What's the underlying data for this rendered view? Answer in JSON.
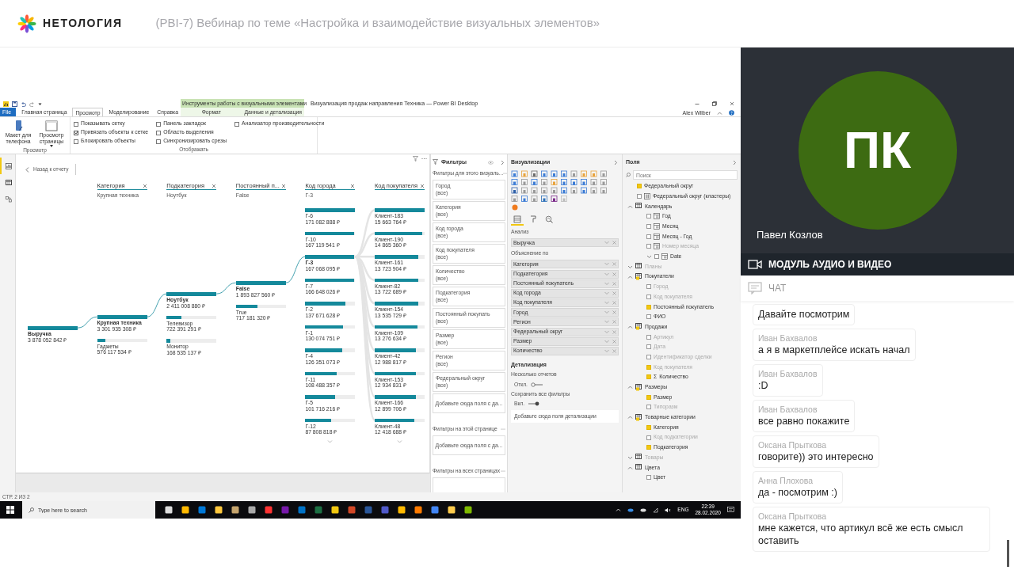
{
  "header": {
    "logo": "НЕТОЛОГИЯ",
    "title": "(PBI-7) Вебинар по теме «Настройка и взаимодействие визуальных элементов»"
  },
  "powerbi": {
    "window_title": "Визуализация продаж направления Техника — Power BI Desktop",
    "context_group": "Инструменты работы с визуальными элементами",
    "user": "Alex Wilber",
    "tabs": [
      {
        "label": "File",
        "kind": "file",
        "selected": false
      },
      {
        "label": "Главная страница",
        "kind": "main",
        "selected": false
      },
      {
        "label": "Просмотр",
        "kind": "main",
        "selected": true
      },
      {
        "label": "Моделирование",
        "kind": "main",
        "selected": false
      },
      {
        "label": "Справка",
        "kind": "main",
        "selected": false
      },
      {
        "label": "Формат",
        "kind": "context",
        "selected": false
      },
      {
        "label": "Данные и детализация",
        "kind": "context",
        "selected": false
      }
    ],
    "ribbon": {
      "buttons": [
        {
          "label": "Макет для телефона",
          "kind": "phone"
        },
        {
          "label": "Просмотр страницы",
          "kind": "page"
        }
      ],
      "view_group": "Просмотр",
      "checkboxes": [
        {
          "label": "Показывать сетку",
          "checked": false
        },
        {
          "label": "Привязать объекты к сетке",
          "checked": true
        },
        {
          "label": "Блокировать объекты",
          "checked": false
        },
        {
          "label": "Панель закладок",
          "checked": false
        },
        {
          "label": "Область выделения",
          "checked": false
        },
        {
          "label": "Синхронизировать срезы",
          "checked": false
        },
        {
          "label": "Анализатор производительности",
          "checked": false
        }
      ],
      "show_group": "Отображать"
    },
    "rail": [
      {
        "kind": "report",
        "selected": true
      },
      {
        "kind": "data",
        "selected": false
      },
      {
        "kind": "model",
        "selected": false
      }
    ],
    "decomposition_tree": {
      "back_link": "Назад к отчету",
      "columns": [
        {
          "nodes": [
            {
              "label": "Выручка",
              "value": "3 878 052 842 ₽",
              "level": 1,
              "selected": true
            }
          ]
        },
        {
          "header": "Категория",
          "filter": "Крупная техника",
          "nodes": [
            {
              "label": "Крупная техника",
              "value": "3 301 935 308 ₽",
              "level": 1,
              "selected": true
            },
            {
              "label": "Гаджеты",
              "value": "576 117 534 ₽",
              "level": 0.17,
              "selected": false
            }
          ]
        },
        {
          "header": "Подкатегория",
          "filter": "Ноутбук",
          "nodes": [
            {
              "label": "Ноутбук",
              "value": "2 411 008 880 ₽",
              "level": 1,
              "selected": true
            },
            {
              "label": "Телевизор",
              "value": "722 391 291 ₽",
              "level": 0.3,
              "selected": false
            },
            {
              "label": "Монитор",
              "value": "168 535 137 ₽",
              "level": 0.07,
              "selected": false
            }
          ]
        },
        {
          "header": "Постоянный п...",
          "filter": "False",
          "nodes": [
            {
              "label": "False",
              "value": "1 893 827 560 ₽",
              "level": 1,
              "selected": true
            },
            {
              "label": "True",
              "value": "717 181 320 ₽",
              "level": 0.43,
              "selected": false
            }
          ]
        },
        {
          "header": "Код города",
          "filter": "Г-3",
          "more": true,
          "nodes": [
            {
              "label": "Г-6",
              "value": "171 082 888 ₽",
              "level": 1,
              "selected": false
            },
            {
              "label": "Г-10",
              "value": "167 119 541 ₽",
              "level": 0.98,
              "selected": false
            },
            {
              "label": "Г-3",
              "value": "167 068 095 ₽",
              "level": 0.98,
              "selected": true
            },
            {
              "label": "Г-7",
              "value": "166 648 026 ₽",
              "level": 0.97,
              "selected": false
            },
            {
              "label": "Г-2",
              "value": "137 671 628 ₽",
              "level": 0.8,
              "selected": false
            },
            {
              "label": "Г-1",
              "value": "130 074 751 ₽",
              "level": 0.76,
              "selected": false
            },
            {
              "label": "Г-4",
              "value": "126 351 073 ₽",
              "level": 0.74,
              "selected": false
            },
            {
              "label": "Г-11",
              "value": "108 488 357 ₽",
              "level": 0.63,
              "selected": false
            },
            {
              "label": "Г-5",
              "value": "101 716 216 ₽",
              "level": 0.59,
              "selected": false
            },
            {
              "label": "Г-12",
              "value": "87 808 818 ₽",
              "level": 0.51,
              "selected": false
            }
          ]
        },
        {
          "header": "Код покупателя",
          "more": true,
          "nodes": [
            {
              "label": "Клиент-183",
              "value": "15 663 764 ₽",
              "level": 1,
              "selected": false
            },
            {
              "label": "Клиент-190",
              "value": "14 865 360 ₽",
              "level": 0.95,
              "selected": false
            },
            {
              "label": "Клиент-161",
              "value": "13 723 904 ₽",
              "level": 0.88,
              "selected": false
            },
            {
              "label": "Клиент-82",
              "value": "13 722 689 ₽",
              "level": 0.88,
              "selected": false
            },
            {
              "label": "Клиент-154",
              "value": "13 535 729 ₽",
              "level": 0.87,
              "selected": false
            },
            {
              "label": "Клиент-109",
              "value": "13 276 634 ₽",
              "level": 0.85,
              "selected": false
            },
            {
              "label": "Клиент-42",
              "value": "12 988 817 ₽",
              "level": 0.83,
              "selected": false
            },
            {
              "label": "Клиент-153",
              "value": "12 934 831 ₽",
              "level": 0.83,
              "selected": false
            },
            {
              "label": "Клиент-166",
              "value": "12 899 706 ₽",
              "level": 0.82,
              "selected": false
            },
            {
              "label": "Клиент-48",
              "value": "12 418 688 ₽",
              "level": 0.79,
              "selected": false
            }
          ]
        }
      ]
    },
    "filters": {
      "title": "Фильтры",
      "visual_label": "Фильтры для этого визуаль...",
      "cards": [
        {
          "field": "Город",
          "value": "(все)"
        },
        {
          "field": "Категория",
          "value": "(все)"
        },
        {
          "field": "Код города",
          "value": "(все)"
        },
        {
          "field": "Код покупателя",
          "value": "(все)"
        },
        {
          "field": "Количество",
          "value": "(все)"
        },
        {
          "field": "Подкатегория",
          "value": "(все)"
        },
        {
          "field": "Постоянный покупать",
          "value": "(все)"
        },
        {
          "field": "Размер",
          "value": "(все)"
        },
        {
          "field": "Регион",
          "value": "(все)"
        },
        {
          "field": "Федеральный округ",
          "value": "(все)"
        }
      ],
      "visual_drop": "Добавьте сюда поля с да...",
      "page_label": "Фильтры на этой странице",
      "page_drop": "Добавьте сюда поля с да...",
      "all_label": "Фильтры на всех страницах"
    },
    "visualizations": {
      "title": "Визуализации",
      "tabs": [
        {
          "kind": "fields",
          "selected": true
        },
        {
          "kind": "format",
          "selected": false
        },
        {
          "kind": "analytics",
          "selected": false
        }
      ],
      "analyze_label": "Анализ",
      "analyze_field": "Выручка",
      "explain_label": "Объяснение по",
      "explain_fields": [
        "Категория",
        "Подкатегория",
        "Постоянный покупатель",
        "Код города",
        "Код покупателя",
        "Город",
        "Регион",
        "Федеральный округ",
        "Размер",
        "Количество"
      ],
      "drillthrough": {
        "title": "Детализация",
        "toggles": [
          {
            "label": "Несколько отчетов",
            "state": "Откл.",
            "on": false
          },
          {
            "label": "Сохранить все фильтры",
            "state": "Вкл.",
            "on": true
          }
        ],
        "drop": "Добавьте сюда поля детализации"
      }
    },
    "fields": {
      "title": "Поля",
      "search": {
        "placeholder": "Поиск"
      },
      "items": [
        {
          "kind": "field",
          "label": "Федеральный округ",
          "checked": true,
          "hidden": false
        },
        {
          "kind": "group",
          "label": "Федеральный округ (кластеры)",
          "checked": false,
          "hidden": false
        },
        {
          "kind": "table",
          "label": "Календарь",
          "expanded": true,
          "hidden": false,
          "children": [
            {
              "kind": "hierarchy",
              "label": "Год",
              "checked": false,
              "hidden": false
            },
            {
              "kind": "hierarchy",
              "label": "Месяц",
              "checked": false,
              "hidden": false
            },
            {
              "kind": "hierarchy",
              "label": "Месяц - Год",
              "checked": false,
              "hidden": false
            },
            {
              "kind": "hierarchy",
              "label": "Номер месяца",
              "checked": false,
              "hidden": true
            },
            {
              "kind": "hierarchy",
              "label": "Date",
              "checked": false,
              "hidden": false,
              "expanded": false
            }
          ]
        },
        {
          "kind": "table",
          "label": "Планы",
          "expanded": false,
          "hidden": true
        },
        {
          "kind": "table",
          "label": "Покупатели",
          "expanded": true,
          "hidden": false,
          "children": [
            {
              "kind": "field",
              "label": "Город",
              "checked": false,
              "hidden": true
            },
            {
              "kind": "field",
              "label": "Код покупателя",
              "checked": false,
              "hidden": true
            },
            {
              "kind": "field",
              "label": "Постоянный покупатель",
              "checked": true,
              "hidden": false
            },
            {
              "kind": "field",
              "label": "ФИО",
              "checked": false,
              "hidden": false
            }
          ]
        },
        {
          "kind": "table",
          "label": "Продажи",
          "expanded": true,
          "hidden": false,
          "children": [
            {
              "kind": "field",
              "label": "Артикул",
              "checked": false,
              "hidden": true
            },
            {
              "kind": "field",
              "label": "Дата",
              "checked": false,
              "hidden": true
            },
            {
              "kind": "field",
              "label": "Идентификатор сделки",
              "checked": false,
              "hidden": true
            },
            {
              "kind": "field",
              "label": "Код покупателя",
              "checked": true,
              "hidden": true
            },
            {
              "kind": "field",
              "label": "Количество",
              "symbol": "Σ",
              "checked": true,
              "hidden": false
            }
          ]
        },
        {
          "kind": "table",
          "label": "Размеры",
          "expanded": true,
          "hidden": false,
          "children": [
            {
              "kind": "field",
              "label": "Размер",
              "checked": true,
              "hidden": false
            },
            {
              "kind": "field",
              "label": "Типоразм",
              "checked": false,
              "hidden": true
            }
          ]
        },
        {
          "kind": "table",
          "label": "Товарные категории",
          "expanded": true,
          "hidden": false,
          "children": [
            {
              "kind": "field",
              "label": "Категория",
              "checked": true,
              "hidden": false
            },
            {
              "kind": "field",
              "label": "Код подкатегории",
              "checked": false,
              "hidden": true
            },
            {
              "kind": "field",
              "label": "Подкатегория",
              "checked": true,
              "hidden": false
            }
          ]
        },
        {
          "kind": "table",
          "label": "Товары",
          "expanded": false,
          "hidden": true
        },
        {
          "kind": "table",
          "label": "Цвета",
          "expanded": true,
          "hidden": false,
          "children": [
            {
              "kind": "field",
              "label": "Цвет",
              "checked": false,
              "hidden": false
            }
          ]
        }
      ]
    },
    "status_bar": "СТР. 2 ИЗ 2",
    "taskbar": {
      "search": {
        "placeholder": "Type here to search"
      },
      "language": "ENG",
      "time": "22:39",
      "date": "28.02.2020"
    }
  },
  "video": {
    "initials": "ПК",
    "name": "Павел Козлов",
    "module_label": "МОДУЛЬ АУДИО И ВИДЕО"
  },
  "chat": {
    "title": "ЧАТ",
    "messages": [
      {
        "text": "Давайте посмотрим"
      },
      {
        "author": "Иван Бахвалов",
        "text": "а я в маркетплейсе искать начал"
      },
      {
        "author": "Иван Бахвалов",
        "text": ":D"
      },
      {
        "author": "Иван Бахвалов",
        "text": "все равно покажите"
      },
      {
        "author": "Оксана Прыткова",
        "text": "говорите)) это интересно"
      },
      {
        "author": "Анна Плохова",
        "text": "да - посмотрим :)"
      },
      {
        "author": "Оксана Прыткова",
        "text": "мне кажется, что артикул всё же есть смысл оставить"
      }
    ]
  }
}
